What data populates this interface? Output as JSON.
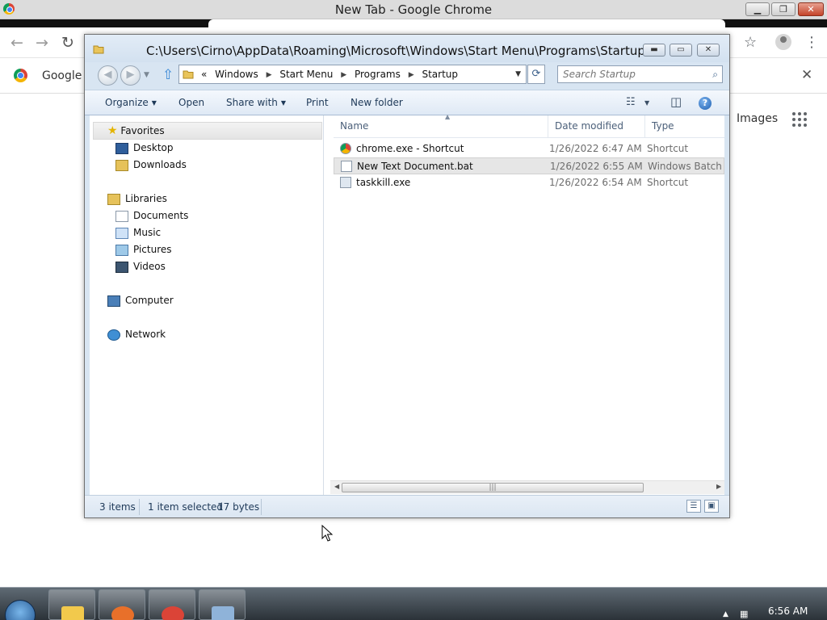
{
  "chrome": {
    "window_title": "New Tab - Google Chrome",
    "min_glyph": "▁",
    "max_glyph": "❐",
    "close_glyph": "✕",
    "back_glyph": "←",
    "forward_glyph": "→",
    "reload_glyph": "↻",
    "star_glyph": "☆",
    "menu_glyph": "⋮",
    "infobar_text": "Google C",
    "infobar_close_glyph": "✕",
    "images_link": "Images"
  },
  "explorer": {
    "title": "C:\\Users\\Cirno\\AppData\\Roaming\\Microsoft\\Windows\\Start Menu\\Programs\\Startup",
    "min_glyph": "▬",
    "max_glyph": "▭",
    "close_glyph": "✕",
    "back_glyph": "◀",
    "forward_glyph": "▶",
    "nav_dropdown_glyph": "▼",
    "up_glyph": "⇧",
    "address": {
      "overflow": "«",
      "crumbs": [
        "Windows",
        "Start Menu",
        "Programs",
        "Startup"
      ],
      "separator_glyph": "▶",
      "dropdown_glyph": "▼"
    },
    "refresh_glyph": "⟳",
    "search_placeholder": "Search Startup",
    "search_icon_glyph": "⌕",
    "commands": {
      "organize": "Organize",
      "open": "Open",
      "share_with": "Share with",
      "print": "Print",
      "new_folder": "New folder",
      "dropdown_glyph": "▼"
    },
    "view_glyph": "☷",
    "view_dropdown_glyph": "▼",
    "preview_glyph": "◫",
    "help_glyph": "?",
    "nav": {
      "favorites": {
        "label": "Favorites",
        "icon": "star-icon",
        "glyph": "★"
      },
      "favorites_items": [
        "Desktop",
        "Downloads"
      ],
      "libraries": "Libraries",
      "libraries_items": [
        "Documents",
        "Music",
        "Pictures",
        "Videos"
      ],
      "computer": "Computer",
      "network": "Network"
    },
    "columns": {
      "name": "Name",
      "date_modified": "Date modified",
      "type": "Type",
      "sort_glyph": "▲"
    },
    "files": [
      {
        "name": "chrome.exe - Shortcut",
        "date": "1/26/2022 6:47 AM",
        "type": "Shortcut",
        "selected": false,
        "icon": "chrome-shortcut-icon"
      },
      {
        "name": "New Text Document.bat",
        "date": "1/26/2022 6:55 AM",
        "type": "Windows Batch File",
        "selected": true,
        "icon": "batch-file-icon"
      },
      {
        "name": "taskkill.exe",
        "date": "1/26/2022 6:54 AM",
        "type": "Shortcut",
        "selected": false,
        "icon": "exe-shortcut-icon"
      }
    ],
    "hscroll": {
      "left_glyph": "◀",
      "right_glyph": "▶",
      "thumb_glyph": "|||"
    },
    "status": {
      "items": "3 items",
      "selected": "1 item selected",
      "size": "17 bytes",
      "details_view_glyph": "☰",
      "icons_view_glyph": "▣"
    }
  },
  "taskbar": {
    "time": "6:56 AM",
    "tray_flag_glyph": "▲",
    "tray_network_glyph": "▦",
    "pinned": [
      "explorer",
      "firefox",
      "chrome",
      "task-manager"
    ],
    "colors": {
      "explorer": "#f2c94c",
      "firefox": "#e8702a",
      "chrome": "#db4437",
      "task-manager": "#8fb3d9"
    }
  }
}
